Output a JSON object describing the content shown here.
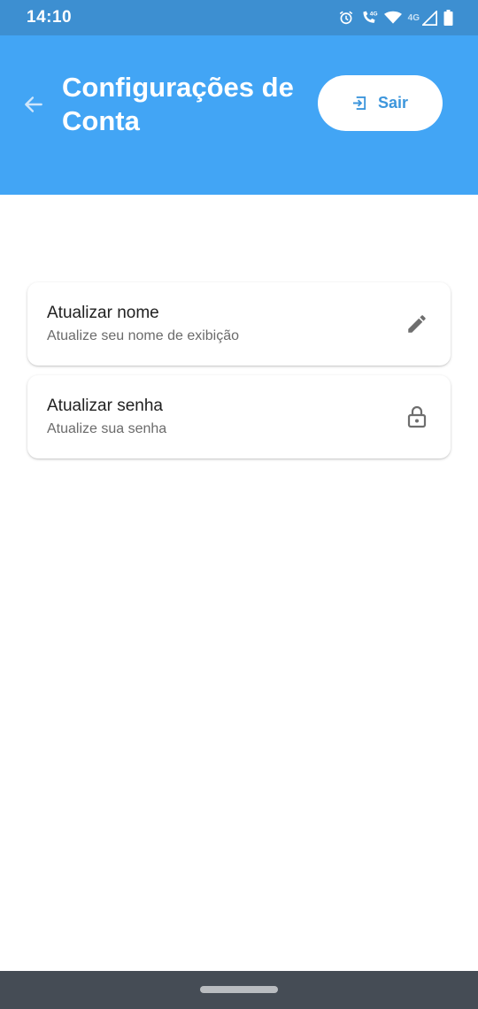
{
  "status_bar": {
    "time": "14:10",
    "network_label": "4G",
    "icons": [
      "alarm-icon",
      "volte-call-icon",
      "wifi-icon",
      "cell-signal-icon",
      "battery-icon"
    ]
  },
  "header": {
    "back_icon": "arrow-back-icon",
    "title": "Configurações de Conta",
    "logout_icon": "exit-icon",
    "logout_label": "Sair",
    "background_color": "#42a5f5"
  },
  "settings": [
    {
      "title": "Atualizar nome",
      "subtitle": "Atualize seu nome de exibição",
      "icon": "edit-pencil-icon"
    },
    {
      "title": "Atualizar senha",
      "subtitle": "Atualize sua senha",
      "icon": "lock-icon"
    }
  ],
  "colors": {
    "status_bar": "#3d8fd1",
    "accent": "#42a5f5",
    "nav_bar": "#454c55"
  }
}
